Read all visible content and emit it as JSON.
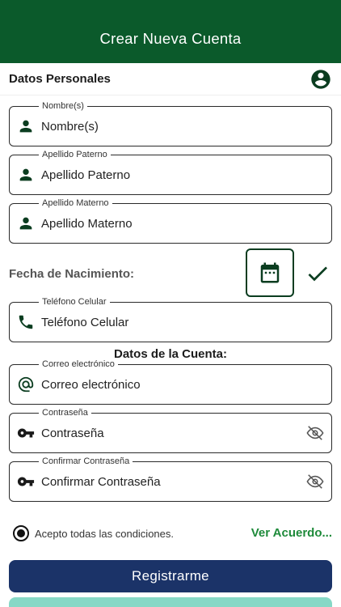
{
  "header": {
    "title": "Crear Nueva Cuenta"
  },
  "personal": {
    "title": "Datos Personales"
  },
  "fields": {
    "nombre": {
      "label": "Nombre(s)",
      "placeholder": "Nombre(s)",
      "icon": "person-icon"
    },
    "paterno": {
      "label": "Apellido Paterno",
      "placeholder": "Apellido Paterno",
      "icon": "person-icon"
    },
    "materno": {
      "label": "Apellido Materno",
      "placeholder": "Apellido Materno",
      "icon": "person-icon"
    },
    "telefono": {
      "label": "Teléfono Celular",
      "placeholder": "Teléfono Celular",
      "icon": "phone-icon"
    },
    "correo": {
      "label": "Correo electrónico",
      "placeholder": "Correo electrónico",
      "icon": "at-sign-icon"
    },
    "password": {
      "label": "Contraseña",
      "placeholder": "Contraseña",
      "icon": "key-icon"
    },
    "confirm": {
      "label": "Confirmar Contraseña",
      "placeholder": "Confirmar Contraseña",
      "icon": "key-icon"
    }
  },
  "fecha": {
    "label": "Fecha de Nacimiento:"
  },
  "cuenta": {
    "title": "Datos de la Cuenta:"
  },
  "terms": {
    "text": "Acepto todas las condiciones.",
    "link": "Ver Acuerdo..."
  },
  "buttons": {
    "register": "Registrarme"
  },
  "colors": {
    "appbar": "#0b5a2b",
    "icon_green": "#0b3d20",
    "link_green": "#1e8a3a",
    "primary_button": "#1b3368",
    "secondary_button": "#86d8c6"
  }
}
